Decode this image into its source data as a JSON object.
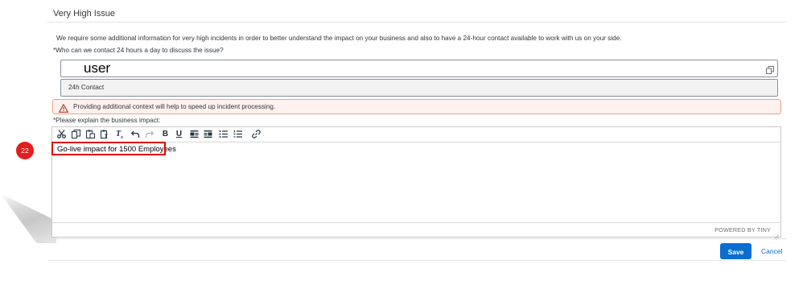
{
  "section": {
    "title": "Very High Issue",
    "description": "We require some additional information for very high incidents in order to better understand the impact on your business and also to have a 24-hour contact available to work with us on your side.",
    "contact_question": "*Who can we contact 24 hours a day to discuss the issue?"
  },
  "contact_field": {
    "value": "user",
    "icon": "copy-icon"
  },
  "contact_type_field": {
    "value": "24h Contact"
  },
  "warning": {
    "icon": "warning-triangle-icon",
    "text": "Providing additional context will help to speed up incident processing."
  },
  "editor": {
    "label": "*Please explain the business impact:",
    "toolbar": [
      "cut",
      "copy",
      "paste",
      "paste-text",
      "clear-formatting",
      "undo",
      "redo",
      "bold",
      "underline",
      "align-left",
      "align-right",
      "bullet-list",
      "numbered-list",
      "link"
    ],
    "content": "Go-live impact for 1500 Employees",
    "powered_by": "POWERED BY TINY"
  },
  "annotation": {
    "step_number": "22",
    "color": "#e51d1d"
  },
  "footer": {
    "save_label": "Save",
    "cancel_label": "Cancel"
  },
  "colors": {
    "accent": "#0a6ed1",
    "warning_bg": "#fff1ed",
    "warning_border": "#e4a48c",
    "highlight": "#e00000"
  }
}
